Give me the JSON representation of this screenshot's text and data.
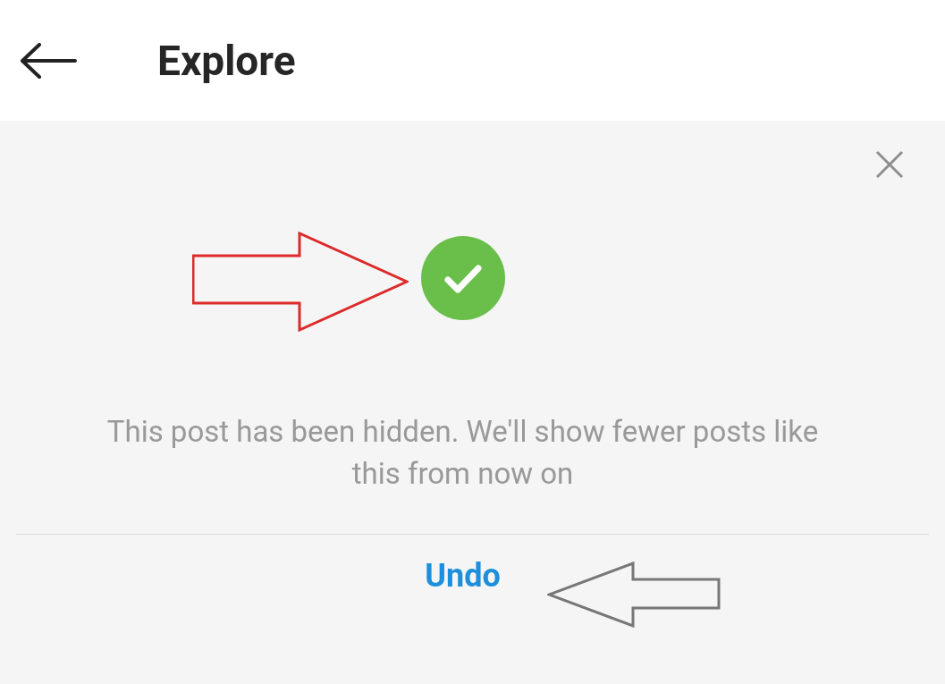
{
  "header": {
    "title": "Explore"
  },
  "notice": {
    "message": "This post has been hidden. We'll show fewer posts like this from now on",
    "action": "Undo"
  }
}
